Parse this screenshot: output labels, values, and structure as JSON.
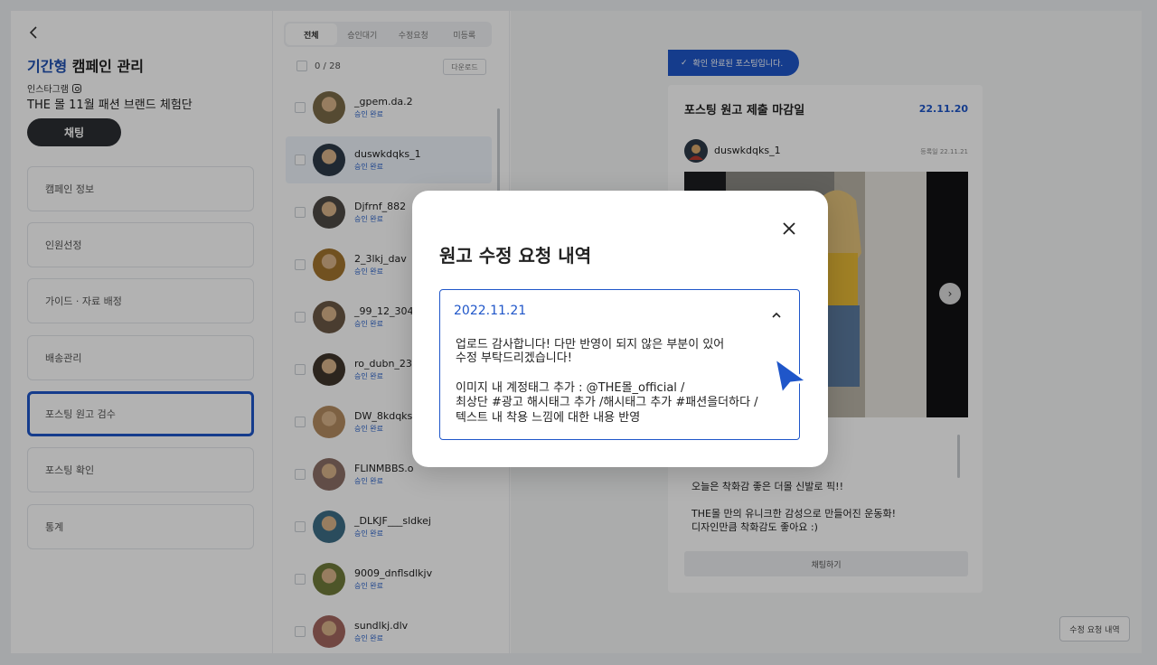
{
  "sidebar": {
    "back_icon": "chevron-left-icon",
    "title_accent": "기간형",
    "title_rest": " 캠페인 관리",
    "platform": "인스타그램",
    "campaign_name": "THE 몰 11월 패션 브랜드 체험단",
    "chat_button": "채팅",
    "menu": [
      {
        "label": "캠페인 정보"
      },
      {
        "label": "인원선정"
      },
      {
        "label": "가이드 · 자료 배정"
      },
      {
        "label": "배송관리"
      },
      {
        "label": "포스팅 원고 검수",
        "active": true
      },
      {
        "label": "포스팅 확인"
      },
      {
        "label": "통계"
      }
    ]
  },
  "list": {
    "tabs": [
      "전체",
      "승인대기",
      "수정요청",
      "미등록"
    ],
    "selected_tab": "전체",
    "count": "0 / 28",
    "download_button": "다운로드",
    "users": [
      {
        "name": "_gpem.da.2",
        "status": "승인 완료",
        "color": "#7a6a48"
      },
      {
        "name": "duswkdqks_1",
        "status": "승인 완료",
        "color": "#2d3a48",
        "highlighted": true
      },
      {
        "name": "Djfrnf_882",
        "status": "승인 완료",
        "color": "#4e4a46"
      },
      {
        "name": "2_3lkj_dav",
        "status": "승인 완료",
        "color": "#a3742f"
      },
      {
        "name": "_99_12_304",
        "status": "승인 완료",
        "color": "#6b5846"
      },
      {
        "name": "ro_dubn_23",
        "status": "승인 완료",
        "color": "#3f352b"
      },
      {
        "name": "DW_8kdqks",
        "status": "승인 완료",
        "color": "#b48c60"
      },
      {
        "name": "FLINMBBS.o",
        "status": "승인 완료",
        "color": "#8c6f66"
      },
      {
        "name": "_DLKJF___sldkej",
        "status": "승인 완료",
        "color": "#3d6d86"
      },
      {
        "name": "9009_dnflsdlkjv",
        "status": "승인 완료",
        "color": "#6f7a3a"
      },
      {
        "name": "sundlkj.dlv",
        "status": "승인 완료",
        "color": "#a2665f"
      }
    ]
  },
  "detail": {
    "confirm_badge": "확인 완료된 포스팅입니다.",
    "deadline_label": "포스팅 원고 제출 마감일",
    "deadline_date": "22.11.20",
    "post_user": "duswkdqks_1",
    "post_regdate": "등록일 22.11.21",
    "caption_1": "오늘은 착화감 좋은 더몰 신발로 픽!!",
    "caption_2": "THE몰 만의 유니크한 감성으로 만들어진 운동화!",
    "caption_3": "디자인만큼 착화감도 좋아요 :)",
    "chat_button": "채팅하기",
    "history_button": "수정 요청 내역"
  },
  "modal": {
    "title": "원고 수정 요청 내역",
    "close_icon": "close-icon",
    "entry": {
      "date": "2022.11.21",
      "lines": [
        "업로드 감사합니다! 다만 반영이 되지 않은 부분이 있어",
        "수정 부탁드리겠습니다!",
        "이미지 내 계정태그 추가 : @THE몰_official /",
        "최상단 #광고 해시태그 추가 /해시태그 추가 #패션을더하다 /",
        "텍스트 내 착용 느낌에 대한 내용 반영"
      ]
    }
  },
  "colors": {
    "accent": "#1f56c9",
    "dark_button": "#2c2f33",
    "status_blue": "#2a62c9"
  }
}
